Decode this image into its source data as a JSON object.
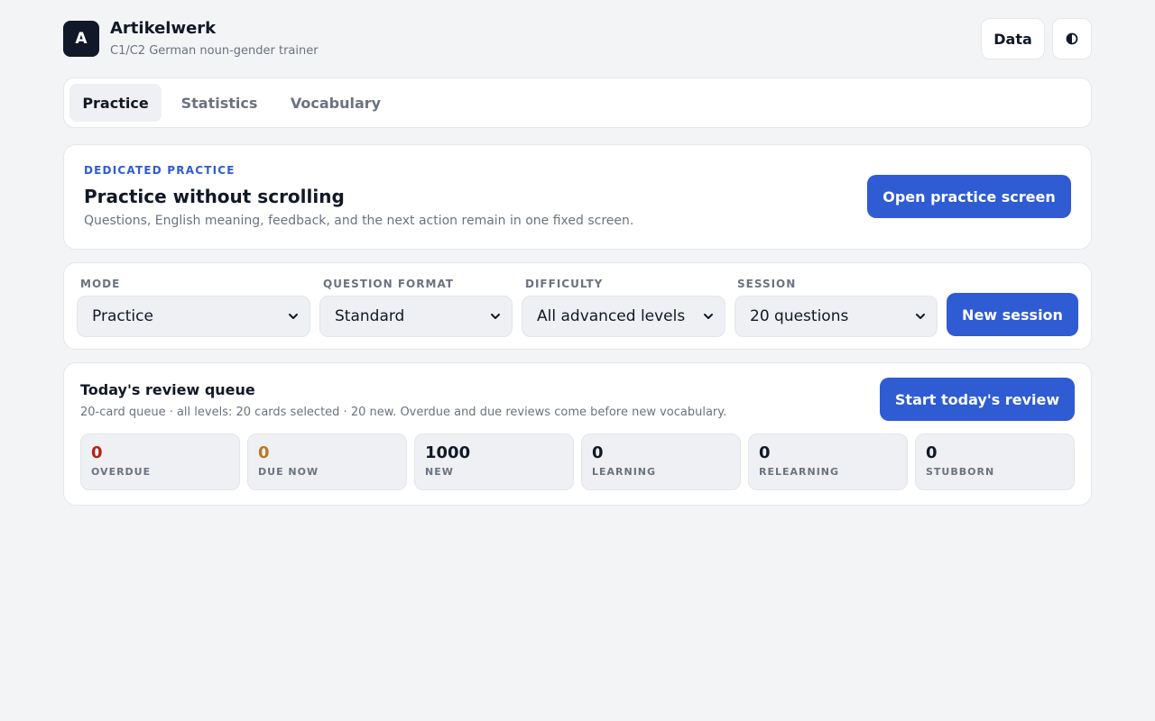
{
  "app": {
    "logo_letter": "A",
    "title": "Artikelwerk",
    "subtitle": "C1/C2 German noun-gender trainer",
    "data_button": "Data",
    "theme_icon": "contrast-icon"
  },
  "tabs": [
    {
      "label": "Practice",
      "active": true
    },
    {
      "label": "Statistics",
      "active": false
    },
    {
      "label": "Vocabulary",
      "active": false
    }
  ],
  "dedicated": {
    "eyebrow": "DEDICATED PRACTICE",
    "title": "Practice without scrolling",
    "description": "Questions, English meaning, feedback, and the next action remain in one fixed screen.",
    "button": "Open practice screen"
  },
  "settings": {
    "mode": {
      "label": "MODE",
      "value": "Practice"
    },
    "format": {
      "label": "QUESTION FORMAT",
      "value": "Standard"
    },
    "difficulty": {
      "label": "DIFFICULTY",
      "value": "All advanced levels"
    },
    "session": {
      "label": "SESSION",
      "value": "20 questions"
    },
    "new_session_button": "New session"
  },
  "review": {
    "title": "Today's review queue",
    "description": "20-card queue · all levels: 20 cards selected · 20 new. Overdue and due reviews come before new vocabulary.",
    "button": "Start today's review",
    "stats": [
      {
        "value": "0",
        "label": "OVERDUE"
      },
      {
        "value": "0",
        "label": "DUE NOW"
      },
      {
        "value": "1000",
        "label": "NEW"
      },
      {
        "value": "0",
        "label": "LEARNING"
      },
      {
        "value": "0",
        "label": "RELEARNING"
      },
      {
        "value": "0",
        "label": "STUBBORN"
      }
    ]
  },
  "colors": {
    "accent": "#2f5bd3",
    "overdue": "#b42318",
    "due": "#b7791f",
    "background": "#f3f4f6"
  }
}
